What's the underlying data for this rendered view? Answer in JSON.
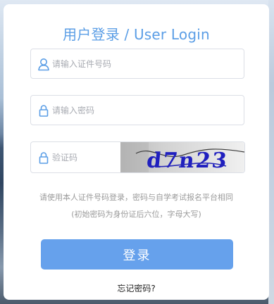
{
  "login": {
    "title": "用户登录 / User Login",
    "id_field": {
      "placeholder": "请输入证件号码",
      "icon": "user-icon"
    },
    "password_field": {
      "placeholder": "请输入密码",
      "icon": "lock-icon"
    },
    "captcha_field": {
      "placeholder": "验证码",
      "icon": "lock-icon",
      "captcha_text": "d7n23"
    },
    "hint_line1": "请使用本人证件号码登录，密码与自学考试报名平台相同",
    "hint_line2": "(初始密码为身份证后六位，字母大写)",
    "submit_label": "登录",
    "forgot_label": "忘记密码?"
  },
  "colors": {
    "accent": "#5b9ee6",
    "button": "#66a1ec",
    "hint": "#9a9a9a",
    "border": "#dcdfe6"
  }
}
